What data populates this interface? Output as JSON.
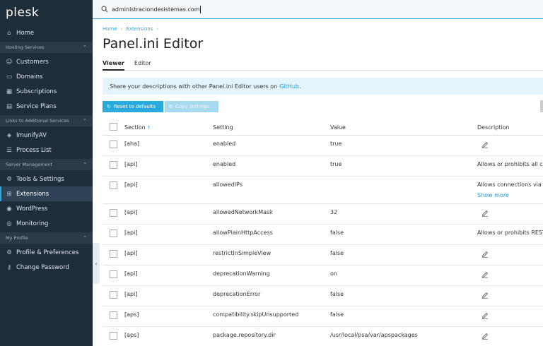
{
  "app": {
    "logo": "plesk"
  },
  "sidebar": {
    "items_top": [
      {
        "label": "Home",
        "icon": "home-icon"
      }
    ],
    "groups": [
      {
        "label": "Hosting Services",
        "items": [
          {
            "label": "Customers",
            "icon": "user-icon"
          },
          {
            "label": "Domains",
            "icon": "monitor-icon"
          },
          {
            "label": "Subscriptions",
            "icon": "grid-icon"
          },
          {
            "label": "Service Plans",
            "icon": "book-icon"
          }
        ]
      },
      {
        "label": "Links to Additional Services",
        "items": [
          {
            "label": "ImunifyAV",
            "icon": "shield-icon"
          },
          {
            "label": "Process List",
            "icon": "list-icon"
          }
        ]
      },
      {
        "label": "Server Management",
        "items": [
          {
            "label": "Tools & Settings",
            "icon": "tools-icon"
          },
          {
            "label": "Extensions",
            "icon": "extensions-icon",
            "active": true
          },
          {
            "label": "WordPress",
            "icon": "wordpress-icon"
          },
          {
            "label": "Monitoring",
            "icon": "monitoring-icon"
          }
        ]
      },
      {
        "label": "My Profile",
        "items": [
          {
            "label": "Profile & Preferences",
            "icon": "profile-icon"
          },
          {
            "label": "Change Password",
            "icon": "key-icon"
          }
        ]
      }
    ]
  },
  "search": {
    "value": "administraciondesistemas.com"
  },
  "breadcrumb": {
    "home": "Home",
    "extensions": "Extensions"
  },
  "page": {
    "title": "Panel.ini Editor"
  },
  "tabs": {
    "viewer": "Viewer",
    "editor": "Editor"
  },
  "info": {
    "text": "Share your descriptions with other Panel.ini Editor users on",
    "link": "GitHub",
    "tail": "."
  },
  "toolbar": {
    "reset": "Reset to defaults",
    "copy": "Copy settings"
  },
  "table": {
    "headers": {
      "section": "Section",
      "setting": "Setting",
      "value": "Value",
      "description": "Description"
    },
    "rows": [
      {
        "section": "[aha]",
        "setting": "enabled",
        "value": "true",
        "description": "",
        "edit": true
      },
      {
        "section": "[api]",
        "setting": "enabled",
        "value": "true",
        "description": "Allows or prohibits all co",
        "edit": false
      },
      {
        "section": "[api]",
        "setting": "allowedIPs",
        "value": "",
        "description": "Allows connections via P",
        "show_more": "Show more",
        "edit": false
      },
      {
        "section": "[api]",
        "setting": "allowedNetworkMask",
        "value": "32",
        "description": "",
        "edit": true
      },
      {
        "section": "[api]",
        "setting": "allowPlainHttpAccess",
        "value": "false",
        "description": "Allows or prohibits REST",
        "edit": false
      },
      {
        "section": "[api]",
        "setting": "restrictInSimpleView",
        "value": "false",
        "description": "",
        "edit": true
      },
      {
        "section": "[api]",
        "setting": "deprecationWarning",
        "value": "on",
        "description": "",
        "edit": true
      },
      {
        "section": "[api]",
        "setting": "deprecationError",
        "value": "false",
        "description": "",
        "edit": true
      },
      {
        "section": "[aps]",
        "setting": "compatibility.skipUnsupported",
        "value": "false",
        "description": "",
        "edit": true
      },
      {
        "section": "[aps]",
        "setting": "package.repository.dir",
        "value": "/usr/local/psa/var/apspackages",
        "description": "",
        "edit": true
      }
    ]
  }
}
